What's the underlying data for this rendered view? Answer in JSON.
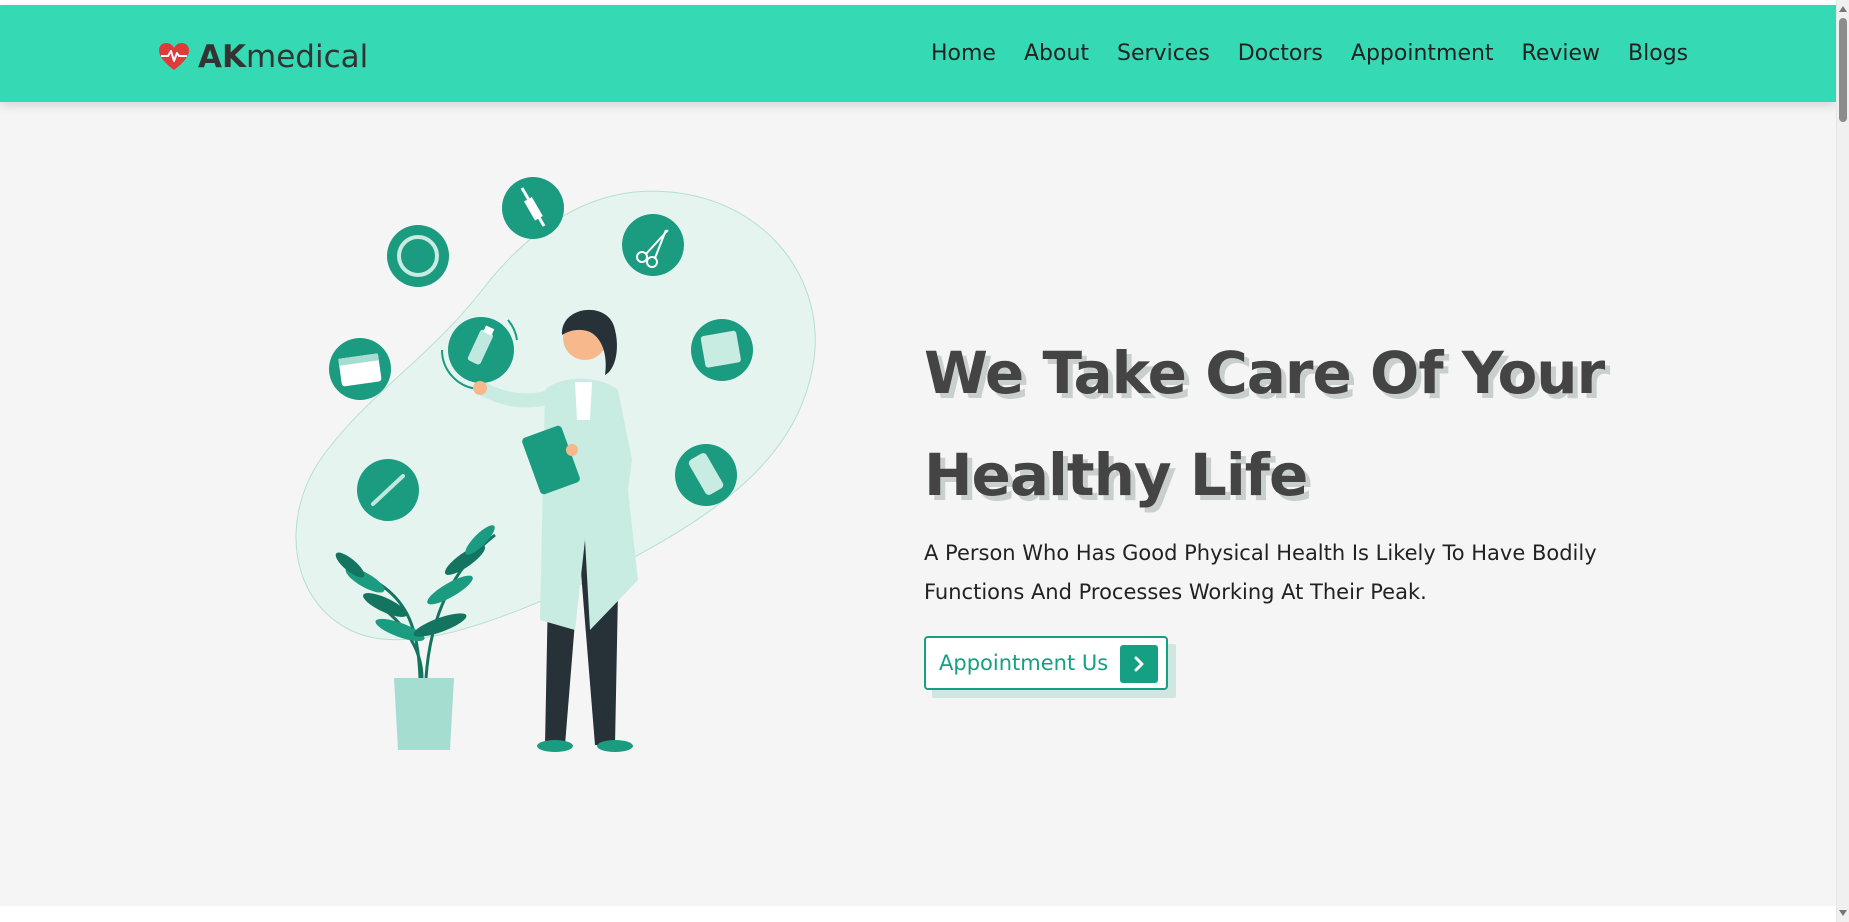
{
  "brand": {
    "name_bold": "AK",
    "name_rest": "medical",
    "logo_icon": "heart-pulse-icon"
  },
  "nav": {
    "items": [
      "Home",
      "About",
      "Services",
      "Doctors",
      "Appointment",
      "Review",
      "Blogs"
    ]
  },
  "hero": {
    "title_line1": "We Take Care Of Your",
    "title_line2": "Healthy Life",
    "description_line1": "A Person Who Has Good Physical Health Is Likely To Have Bodily",
    "description_line2": "Functions And Processes Working At Their Peak.",
    "cta_label": "Appointment Us",
    "cta_icon": "chevron-right-icon"
  },
  "colors": {
    "header_bg": "#35dab4",
    "accent": "#16a083",
    "page_bg": "#f5f5f5",
    "heading": "#444444",
    "heart": "#e03b3b"
  }
}
